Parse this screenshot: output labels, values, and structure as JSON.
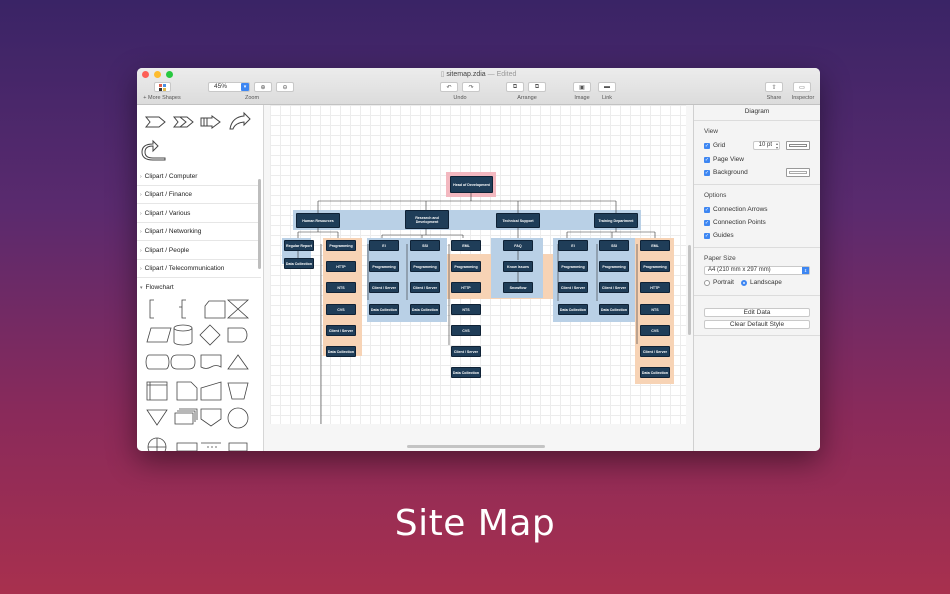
{
  "window": {
    "title": "sitemap.zdia",
    "edited": "— Edited"
  },
  "toolbar": {
    "more_shapes": "+ More Shapes",
    "zoom_value": "45%",
    "zoom_label": "Zoom",
    "undo_label": "Undo",
    "arrange_label": "Arrange",
    "image_label": "Image",
    "link_label": "Link",
    "share_label": "Share",
    "inspector_label": "Inspector"
  },
  "sidebar": {
    "categories": [
      "Clipart / Computer",
      "Clipart / Finance",
      "Clipart / Various",
      "Clipart / Networking",
      "Clipart / People",
      "Clipart / Telecommunication",
      "Flowchart"
    ]
  },
  "diagram": {
    "root": "Head of Development",
    "departments": [
      "Human Resources",
      "Research and Development",
      "Technical Support",
      "Training Department"
    ],
    "nodes": {
      "regular_report": "Regular Report",
      "data_collection": "Data Collection",
      "programming": "Programming",
      "http": "HTTP",
      "nts": "NTS",
      "cvs": "CVS",
      "client_server": "Client / Server",
      "ei": "EI",
      "ssi": "SSI",
      "eml": "EML",
      "faq": "FAQ",
      "know_issues": "Know Issues",
      "snowflow": "Snowflow"
    }
  },
  "inspector": {
    "title": "Diagram",
    "view_head": "View",
    "grid": "Grid",
    "grid_size": "10 pt",
    "page_view": "Page View",
    "background": "Background",
    "options_head": "Options",
    "connection_arrows": "Connection Arrows",
    "connection_points": "Connection Points",
    "guides": "Guides",
    "paper_size_head": "Paper Size",
    "paper_size": "A4 (210 mm x 297 mm)",
    "portrait": "Portrait",
    "landscape": "Landscape",
    "edit_data": "Edit Data",
    "clear_default_style": "Clear Default Style"
  },
  "caption": "Site Map",
  "colors": {
    "accent": "#3d86f2",
    "node_fill": "#1f3d58",
    "blue_group": "#b9d0e6",
    "orange_group": "#f7d3b5",
    "root_highlight": "#f3b8c0"
  }
}
